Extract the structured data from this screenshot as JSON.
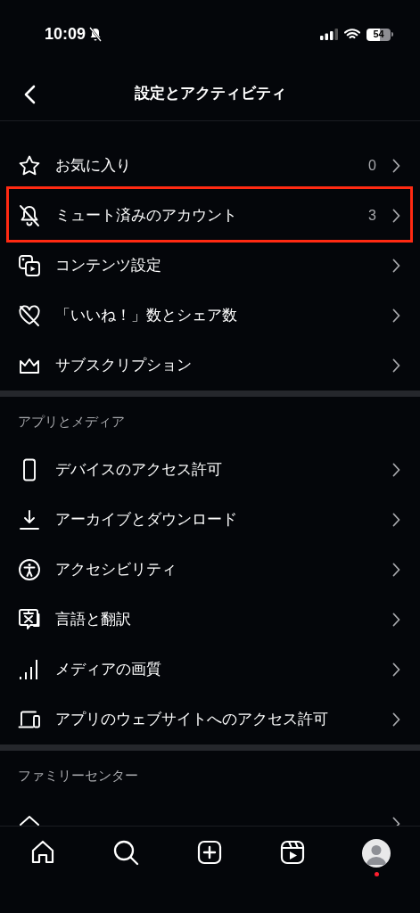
{
  "status_bar": {
    "time": "10:09",
    "battery": "54"
  },
  "header": {
    "title": "設定とアクティビティ"
  },
  "sections": [
    {
      "items": [
        {
          "label": "お気に入り",
          "count": "0",
          "highlighted": false
        },
        {
          "label": "ミュート済みのアカウント",
          "count": "3",
          "highlighted": true
        },
        {
          "label": "コンテンツ設定",
          "highlighted": false
        },
        {
          "label": "「いいね！」数とシェア数",
          "highlighted": false
        },
        {
          "label": "サブスクリプション",
          "highlighted": false
        }
      ]
    },
    {
      "title": "アプリとメディア",
      "items": [
        {
          "label": "デバイスのアクセス許可",
          "highlighted": false
        },
        {
          "label": "アーカイブとダウンロード",
          "highlighted": false
        },
        {
          "label": "アクセシビリティ",
          "highlighted": false
        },
        {
          "label": "言語と翻訳",
          "highlighted": false
        },
        {
          "label": "メディアの画質",
          "highlighted": false
        },
        {
          "label": "アプリのウェブサイトへのアクセス許可",
          "highlighted": false
        }
      ]
    },
    {
      "title": "ファミリーセンター",
      "items": [
        {
          "highlighted": false
        }
      ]
    }
  ],
  "nav": {
    "profile_badge": true
  }
}
